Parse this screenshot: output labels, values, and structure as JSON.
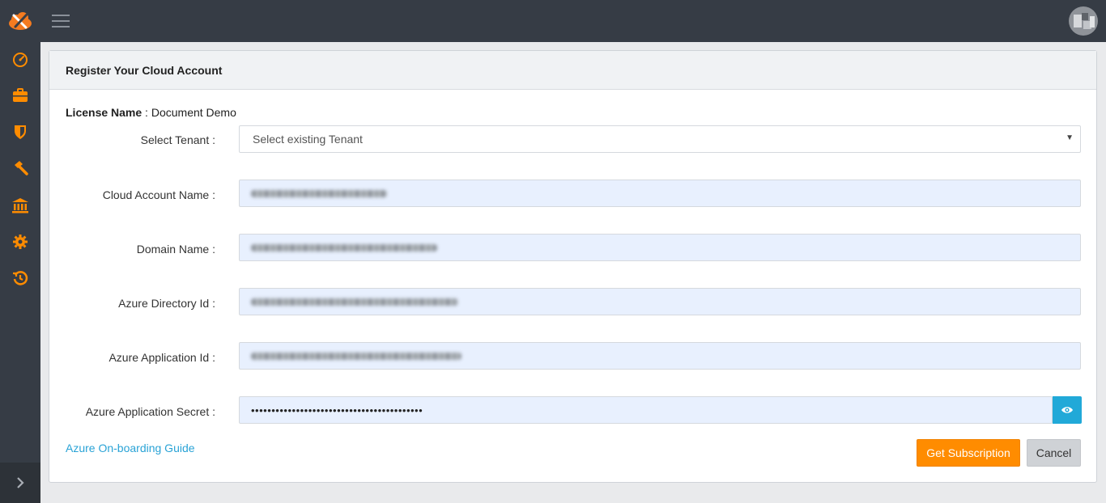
{
  "colors": {
    "accent": "#ff8c00",
    "sidebar_bg": "#363c45",
    "info": "#21a9d8",
    "link": "#2aa3d6"
  },
  "topbar": {
    "logo_icon": "cloud-tools-logo",
    "menu_icon": "hamburger-icon",
    "avatar_icon": "user-avatar"
  },
  "sidebar": {
    "items": [
      {
        "icon": "speedometer-icon"
      },
      {
        "icon": "briefcase-icon"
      },
      {
        "icon": "shield-icon"
      },
      {
        "icon": "hammer-icon"
      },
      {
        "icon": "bank-icon"
      },
      {
        "icon": "gear-icon"
      },
      {
        "icon": "history-icon"
      }
    ],
    "expand_icon": "chevron-right-icon"
  },
  "panel": {
    "title": "Register Your Cloud Account",
    "license_label": "License Name",
    "license_sep": " : ",
    "license_value": "Document Demo"
  },
  "form": {
    "tenant_label": "Select Tenant :",
    "tenant_placeholder": "Select existing Tenant",
    "cloud_account_label": "Cloud Account Name :",
    "domain_label": "Domain Name :",
    "directory_label": "Azure Directory Id :",
    "app_id_label": "Azure Application Id :",
    "secret_label": "Azure Application Secret :",
    "secret_value": "••••••••••••••••••••••••••••••••••••••••••"
  },
  "footer": {
    "guide_link": "Azure On-boarding Guide",
    "submit_label": "Get Subscription",
    "cancel_label": "Cancel"
  }
}
